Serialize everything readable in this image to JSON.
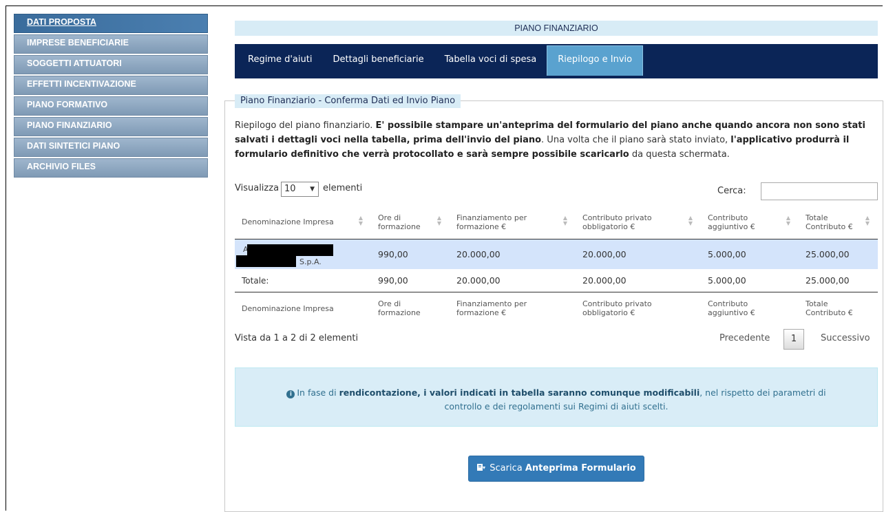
{
  "sidebar": {
    "items": [
      {
        "label": "DATI PROPOSTA",
        "active": true
      },
      {
        "label": "IMPRESE BENEFICIARIE"
      },
      {
        "label": "SOGGETTI ATTUATORI"
      },
      {
        "label": "EFFETTI INCENTIVAZIONE"
      },
      {
        "label": "PIANO FORMATIVO"
      },
      {
        "label": "PIANO FINANZIARIO"
      },
      {
        "label": "DATI SINTETICI PIANO"
      },
      {
        "label": "ARCHIVIO FILES"
      }
    ]
  },
  "header": {
    "title": "PIANO FINANZIARIO"
  },
  "tabs": [
    {
      "label": "Regime d'aiuti"
    },
    {
      "label": "Dettagli beneficiarie"
    },
    {
      "label": "Tabella voci di spesa"
    },
    {
      "label": "Riepilogo e Invio",
      "active": true
    }
  ],
  "section": {
    "legend": "Piano Finanziario - Conferma Dati ed Invio Piano",
    "intro": {
      "p1": "Riepilogo del piano finanziario. ",
      "b1": "E' possibile stampare un'anteprima del formulario del piano anche quando ancora non sono stati salvati i dettagli voci nella tabella, prima dell'invio del piano",
      "p2": ". Una volta che il piano sarà stato inviato, ",
      "b2": "l'applicativo produrrà il formulario definitivo che verrà protocollato e sarà sempre possibile scaricarlo",
      "p3": " da questa schermata."
    }
  },
  "table_controls": {
    "show_label": "Visualizza",
    "page_size": "10",
    "entries_label": "elementi",
    "search_label": "Cerca:",
    "search_value": ""
  },
  "table": {
    "columns": [
      "Denominazione Impresa",
      "Ore di formazione",
      "Finanziamento per formazione €",
      "Contributo privato obbligatorio €",
      "Contributo aggiuntivo €",
      "Totale Contributo €"
    ],
    "row": {
      "name_start": "A",
      "name_end": "S.p.A.",
      "ore": "990,00",
      "finanziamento": "20.000,00",
      "contributo_privato": "20.000,00",
      "contributo_aggiuntivo": "5.000,00",
      "totale": "25.000,00"
    },
    "total_row": {
      "label": "Totale:",
      "ore": "990,00",
      "finanziamento": "20.000,00",
      "contributo_privato": "20.000,00",
      "contributo_aggiuntivo": "5.000,00",
      "totale": "25.000,00"
    }
  },
  "pagination": {
    "info": "Vista da 1 a 2 di 2 elementi",
    "prev": "Precedente",
    "page": "1",
    "next": "Successivo"
  },
  "alert": {
    "p1": "In fase di ",
    "b1": "rendicontazione, i valori indicati in tabella saranno comunque modificabili",
    "p2": ", nel rispetto dei parametri di controllo e dei regolamenti sui Regimi di aiuti scelti."
  },
  "download": {
    "label_prefix": "Scarica ",
    "label_bold": "Anteprima Formulario"
  },
  "colors": {
    "nav": "#0b2557",
    "active_tab": "#5aa2cf",
    "sidebar": "#7f9ab5",
    "button": "#337ab7",
    "alert_bg": "#d9edf7"
  }
}
